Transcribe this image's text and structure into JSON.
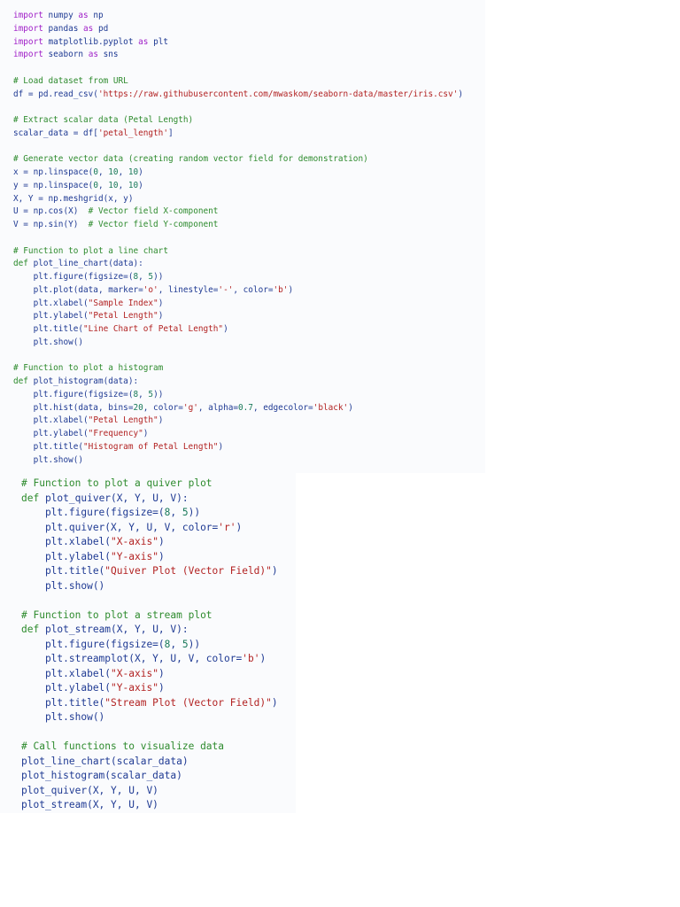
{
  "code_blocks": [
    {
      "lines": [
        [
          [
            "kw",
            "import"
          ],
          [
            "id",
            " numpy "
          ],
          [
            "kw",
            "as"
          ],
          [
            "id",
            " np"
          ]
        ],
        [
          [
            "kw",
            "import"
          ],
          [
            "id",
            " pandas "
          ],
          [
            "kw",
            "as"
          ],
          [
            "id",
            " pd"
          ]
        ],
        [
          [
            "kw",
            "import"
          ],
          [
            "id",
            " matplotlib.pyplot "
          ],
          [
            "kw",
            "as"
          ],
          [
            "id",
            " plt"
          ]
        ],
        [
          [
            "kw",
            "import"
          ],
          [
            "id",
            " seaborn "
          ],
          [
            "kw",
            "as"
          ],
          [
            "id",
            " sns"
          ]
        ],
        [],
        [
          [
            "cm",
            "# Load dataset from URL"
          ]
        ],
        [
          [
            "id",
            "df = pd.read_csv("
          ],
          [
            "str",
            "'https://raw.githubusercontent.com/mwaskom/seaborn-data/master/iris.csv'"
          ],
          [
            "id",
            ")"
          ]
        ],
        [],
        [
          [
            "cm",
            "# Extract scalar data (Petal Length)"
          ]
        ],
        [
          [
            "id",
            "scalar_data = df["
          ],
          [
            "str",
            "'petal_length'"
          ],
          [
            "id",
            "]"
          ]
        ],
        [],
        [
          [
            "cm",
            "# Generate vector data (creating random vector field for demonstration)"
          ]
        ],
        [
          [
            "id",
            "x = np.linspace("
          ],
          [
            "num",
            "0"
          ],
          [
            "id",
            ", "
          ],
          [
            "num",
            "10"
          ],
          [
            "id",
            ", "
          ],
          [
            "num",
            "10"
          ],
          [
            "id",
            ")"
          ]
        ],
        [
          [
            "id",
            "y = np.linspace("
          ],
          [
            "num",
            "0"
          ],
          [
            "id",
            ", "
          ],
          [
            "num",
            "10"
          ],
          [
            "id",
            ", "
          ],
          [
            "num",
            "10"
          ],
          [
            "id",
            ")"
          ]
        ],
        [
          [
            "id",
            "X, Y = np.meshgrid(x, y)"
          ]
        ],
        [
          [
            "id",
            "U = np.cos(X)  "
          ],
          [
            "cm",
            "# Vector field X-component"
          ]
        ],
        [
          [
            "id",
            "V = np.sin(Y)  "
          ],
          [
            "cm",
            "# Vector field Y-component"
          ]
        ],
        [],
        [
          [
            "cm",
            "# Function to plot a line chart"
          ]
        ],
        [
          [
            "def",
            "def"
          ],
          [
            "id",
            " plot_line_chart(data):"
          ]
        ],
        [
          [
            "id",
            "    plt.figure(figsize=("
          ],
          [
            "num",
            "8"
          ],
          [
            "id",
            ", "
          ],
          [
            "num",
            "5"
          ],
          [
            "id",
            "))"
          ]
        ],
        [
          [
            "id",
            "    plt.plot(data, marker="
          ],
          [
            "str",
            "'o'"
          ],
          [
            "id",
            ", linestyle="
          ],
          [
            "str",
            "'-'"
          ],
          [
            "id",
            ", color="
          ],
          [
            "str",
            "'b'"
          ],
          [
            "id",
            ")"
          ]
        ],
        [
          [
            "id",
            "    plt.xlabel("
          ],
          [
            "str",
            "\"Sample Index\""
          ],
          [
            "id",
            ")"
          ]
        ],
        [
          [
            "id",
            "    plt.ylabel("
          ],
          [
            "str",
            "\"Petal Length\""
          ],
          [
            "id",
            ")"
          ]
        ],
        [
          [
            "id",
            "    plt.title("
          ],
          [
            "str",
            "\"Line Chart of Petal Length\""
          ],
          [
            "id",
            ")"
          ]
        ],
        [
          [
            "id",
            "    plt.show()"
          ]
        ],
        [],
        [
          [
            "cm",
            "# Function to plot a histogram"
          ]
        ],
        [
          [
            "def",
            "def"
          ],
          [
            "id",
            " plot_histogram(data):"
          ]
        ],
        [
          [
            "id",
            "    plt.figure(figsize=("
          ],
          [
            "num",
            "8"
          ],
          [
            "id",
            ", "
          ],
          [
            "num",
            "5"
          ],
          [
            "id",
            "))"
          ]
        ],
        [
          [
            "id",
            "    plt.hist(data, bins="
          ],
          [
            "num",
            "20"
          ],
          [
            "id",
            ", color="
          ],
          [
            "str",
            "'g'"
          ],
          [
            "id",
            ", alpha="
          ],
          [
            "num",
            "0.7"
          ],
          [
            "id",
            ", edgecolor="
          ],
          [
            "str",
            "'black'"
          ],
          [
            "id",
            ")"
          ]
        ],
        [
          [
            "id",
            "    plt.xlabel("
          ],
          [
            "str",
            "\"Petal Length\""
          ],
          [
            "id",
            ")"
          ]
        ],
        [
          [
            "id",
            "    plt.ylabel("
          ],
          [
            "str",
            "\"Frequency\""
          ],
          [
            "id",
            ")"
          ]
        ],
        [
          [
            "id",
            "    plt.title("
          ],
          [
            "str",
            "\"Histogram of Petal Length\""
          ],
          [
            "id",
            ")"
          ]
        ],
        [
          [
            "id",
            "    plt.show()"
          ]
        ]
      ]
    },
    {
      "lines": [
        [
          [
            "cm",
            "# Function to plot a quiver plot"
          ]
        ],
        [
          [
            "def",
            "def"
          ],
          [
            "id",
            " plot_quiver(X, Y, U, V):"
          ]
        ],
        [
          [
            "id",
            "    plt.figure(figsize=("
          ],
          [
            "num",
            "8"
          ],
          [
            "id",
            ", "
          ],
          [
            "num",
            "5"
          ],
          [
            "id",
            "))"
          ]
        ],
        [
          [
            "id",
            "    plt.quiver(X, Y, U, V, color="
          ],
          [
            "str",
            "'r'"
          ],
          [
            "id",
            ")"
          ]
        ],
        [
          [
            "id",
            "    plt.xlabel("
          ],
          [
            "str",
            "\"X-axis\""
          ],
          [
            "id",
            ")"
          ]
        ],
        [
          [
            "id",
            "    plt.ylabel("
          ],
          [
            "str",
            "\"Y-axis\""
          ],
          [
            "id",
            ")"
          ]
        ],
        [
          [
            "id",
            "    plt.title("
          ],
          [
            "str",
            "\"Quiver Plot (Vector Field)\""
          ],
          [
            "id",
            ")"
          ]
        ],
        [
          [
            "id",
            "    plt.show()"
          ]
        ],
        [],
        [
          [
            "cm",
            "# Function to plot a stream plot"
          ]
        ],
        [
          [
            "def",
            "def"
          ],
          [
            "id",
            " plot_stream(X, Y, U, V):"
          ]
        ],
        [
          [
            "id",
            "    plt.figure(figsize=("
          ],
          [
            "num",
            "8"
          ],
          [
            "id",
            ", "
          ],
          [
            "num",
            "5"
          ],
          [
            "id",
            "))"
          ]
        ],
        [
          [
            "id",
            "    plt.streamplot(X, Y, U, V, color="
          ],
          [
            "str",
            "'b'"
          ],
          [
            "id",
            ")"
          ]
        ],
        [
          [
            "id",
            "    plt.xlabel("
          ],
          [
            "str",
            "\"X-axis\""
          ],
          [
            "id",
            ")"
          ]
        ],
        [
          [
            "id",
            "    plt.ylabel("
          ],
          [
            "str",
            "\"Y-axis\""
          ],
          [
            "id",
            ")"
          ]
        ],
        [
          [
            "id",
            "    plt.title("
          ],
          [
            "str",
            "\"Stream Plot (Vector Field)\""
          ],
          [
            "id",
            ")"
          ]
        ],
        [
          [
            "id",
            "    plt.show()"
          ]
        ],
        [],
        [
          [
            "cm",
            "# Call functions to visualize data"
          ]
        ],
        [
          [
            "id",
            "plot_line_chart(scalar_data)"
          ]
        ],
        [
          [
            "id",
            "plot_histogram(scalar_data)"
          ]
        ],
        [
          [
            "id",
            "plot_quiver(X, Y, U, V)"
          ]
        ],
        [
          [
            "id",
            "plot_stream(X, Y, U, V)"
          ]
        ]
      ]
    }
  ]
}
